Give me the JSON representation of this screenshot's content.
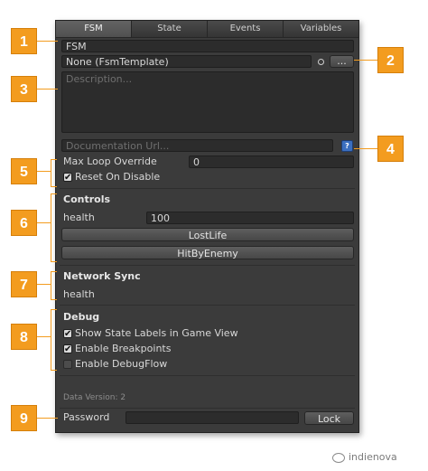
{
  "tabs": [
    "FSM",
    "State",
    "Events",
    "Variables"
  ],
  "fsm": {
    "name": "FSM",
    "template": "None (FsmTemplate)",
    "template_button": "...",
    "description_placeholder": "Description...",
    "doc_url_placeholder": "Documentation Url...",
    "help_icon": "?"
  },
  "settings": {
    "max_loop_label": "Max Loop Override",
    "max_loop_value": "0",
    "reset_on_disable": "Reset On Disable",
    "reset_checked": true
  },
  "controls": {
    "heading": "Controls",
    "variable_label": "health",
    "variable_value": "100",
    "events": [
      "LostLife",
      "HitByEnemy"
    ]
  },
  "network": {
    "heading": "Network Sync",
    "variable_label": "health"
  },
  "debug": {
    "heading": "Debug",
    "options": [
      {
        "label": "Show State Labels in Game View",
        "checked": true
      },
      {
        "label": "Enable Breakpoints",
        "checked": true
      },
      {
        "label": "Enable DebugFlow",
        "checked": false
      }
    ]
  },
  "footer": {
    "data_version": "Data Version: 2",
    "password_label": "Password",
    "lock_button": "Lock"
  },
  "callouts": [
    "1",
    "2",
    "3",
    "4",
    "5",
    "6",
    "7",
    "8",
    "9"
  ],
  "watermark": "indienova",
  "colors": {
    "callout": "#f39c1f",
    "panel": "#3b3b3b",
    "field": "#2c2c2c"
  }
}
